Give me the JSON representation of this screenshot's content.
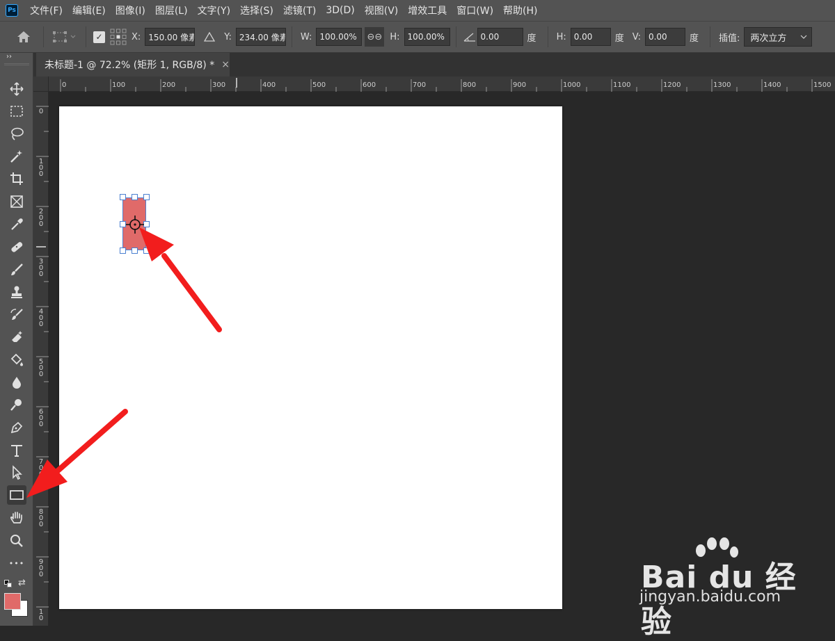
{
  "app": {
    "logo_text": "Ps"
  },
  "menu": [
    "文件(F)",
    "编辑(E)",
    "图像(I)",
    "图层(L)",
    "文字(Y)",
    "选择(S)",
    "滤镜(T)",
    "3D(D)",
    "视图(V)",
    "增效工具",
    "窗口(W)",
    "帮助(H)"
  ],
  "options": {
    "x_label": "X:",
    "x_value": "150.00 像素",
    "y_label": "Y:",
    "y_value": "234.00 像素",
    "w_label": "W:",
    "w_value": "100.00%",
    "h_label": "H:",
    "h_value": "100.00%",
    "angle_value": "0.00",
    "angle_unit": "度",
    "hskew_label": "H:",
    "hskew_value": "0.00",
    "hskew_unit": "度",
    "vskew_label": "V:",
    "vskew_value": "0.00",
    "vskew_unit": "度",
    "interp_label": "插值:",
    "interp_value": "两次立方"
  },
  "document": {
    "tab_title": "未标题-1 @ 72.2% (矩形 1, RGB/8) *",
    "close_glyph": "×"
  },
  "ruler": {
    "top": [
      "0",
      "100",
      "200",
      "300",
      "400",
      "500",
      "600",
      "700",
      "800",
      "900",
      "1000",
      "1100",
      "1200",
      "1300",
      "1400",
      "1500"
    ],
    "left": [
      "0",
      "1\n0\n0",
      "2\n0\n0",
      "3\n0\n0",
      "4\n0\n0",
      "5\n0\n0",
      "6\n0\n0",
      "7\n0\n0",
      "8\n0\n0",
      "9\n0\n0",
      "1\n0"
    ]
  },
  "toolbar": {
    "collapse_glyph": "››",
    "more_glyph": "•••"
  },
  "colors": {
    "foreground": "#e06a69",
    "background": "#ffffff",
    "accent_arrow": "#f21d1d",
    "selection": "#4a7fd0"
  },
  "watermark": {
    "brand": "Bai du 经验",
    "site": "jingyan.baidu.com"
  }
}
